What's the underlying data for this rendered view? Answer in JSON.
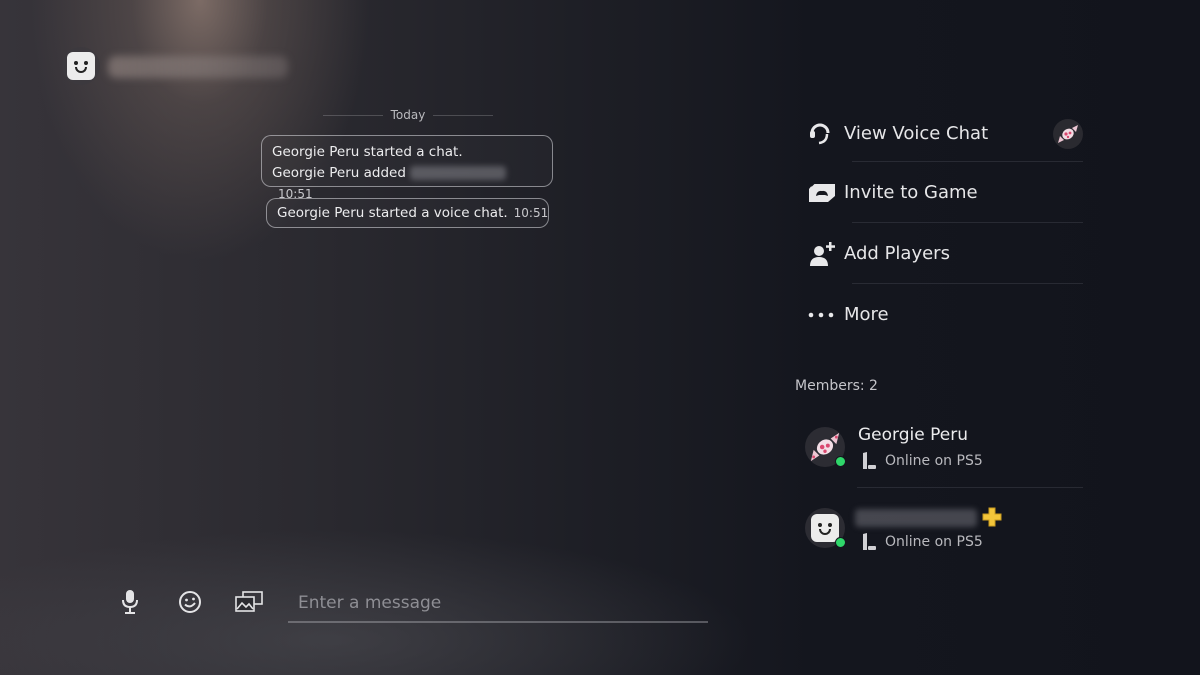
{
  "header": {
    "avatar_icon": "bot-face-avatar",
    "name_redacted": true
  },
  "chat": {
    "date_separator": "Today",
    "messages": [
      {
        "line1": "Georgie Peru started a chat.",
        "line2": "Georgie Peru added",
        "line2_redacted": true,
        "time": "10:51"
      },
      {
        "text": "Georgie Peru started a voice chat.",
        "time": "10:51"
      }
    ]
  },
  "composer": {
    "placeholder": "Enter a message",
    "icons": [
      "microphone-icon",
      "emoji-icon",
      "media-icon"
    ]
  },
  "menu": {
    "items": [
      {
        "label": "View Voice Chat",
        "icon": "headset-icon"
      },
      {
        "label": "Invite to Game",
        "icon": "invite-game-icon"
      },
      {
        "label": "Add Players",
        "icon": "add-player-icon"
      },
      {
        "label": "More",
        "icon": "more-dots-icon"
      }
    ]
  },
  "members": {
    "label": "Members: 2",
    "list": [
      {
        "name": "Georgie Peru",
        "status": "Online on PS5",
        "avatar": "candy-avatar",
        "online": true
      },
      {
        "name_redacted": true,
        "status": "Online on PS5",
        "avatar": "bot-face-avatar",
        "online": true,
        "ps_plus": true
      }
    ]
  },
  "colors": {
    "online": "#2fd66a",
    "ps_plus": "#f3c53a"
  }
}
